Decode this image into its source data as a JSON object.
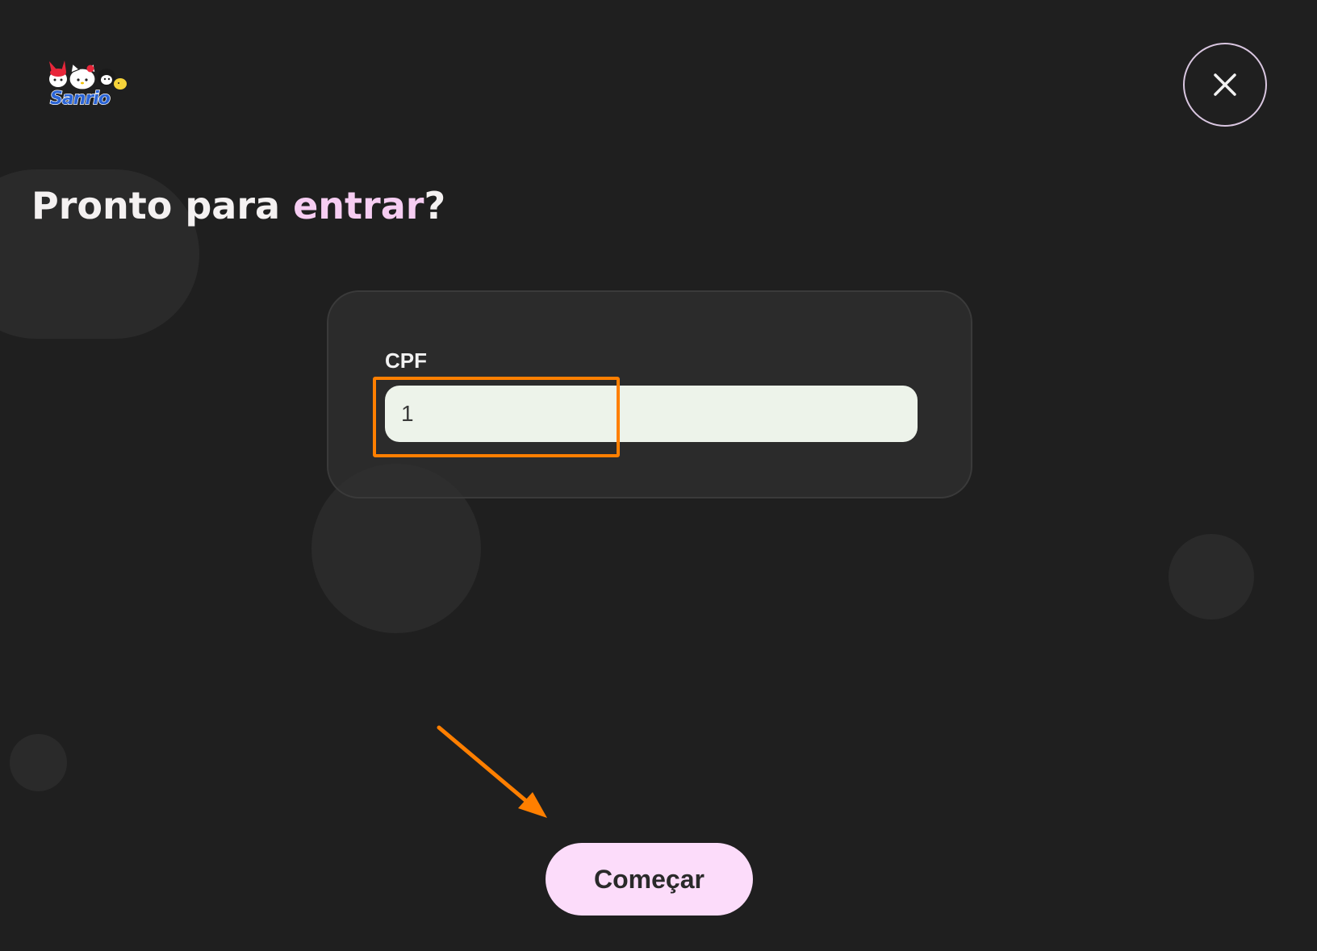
{
  "header": {
    "logo_text": "Sanrio",
    "close_icon": "close-icon"
  },
  "heading": {
    "part1": "Pronto para ",
    "accent": "entrar",
    "part2": "?"
  },
  "form": {
    "cpf_label": "CPF",
    "cpf_value": "1"
  },
  "actions": {
    "start_label": "Começar"
  },
  "colors": {
    "background": "#1f1f1f",
    "accent_pink": "#f6cdf2",
    "button_pink": "#fcdcfa",
    "input_bg": "#edf3ea",
    "annotation_orange": "#ff7f00"
  }
}
